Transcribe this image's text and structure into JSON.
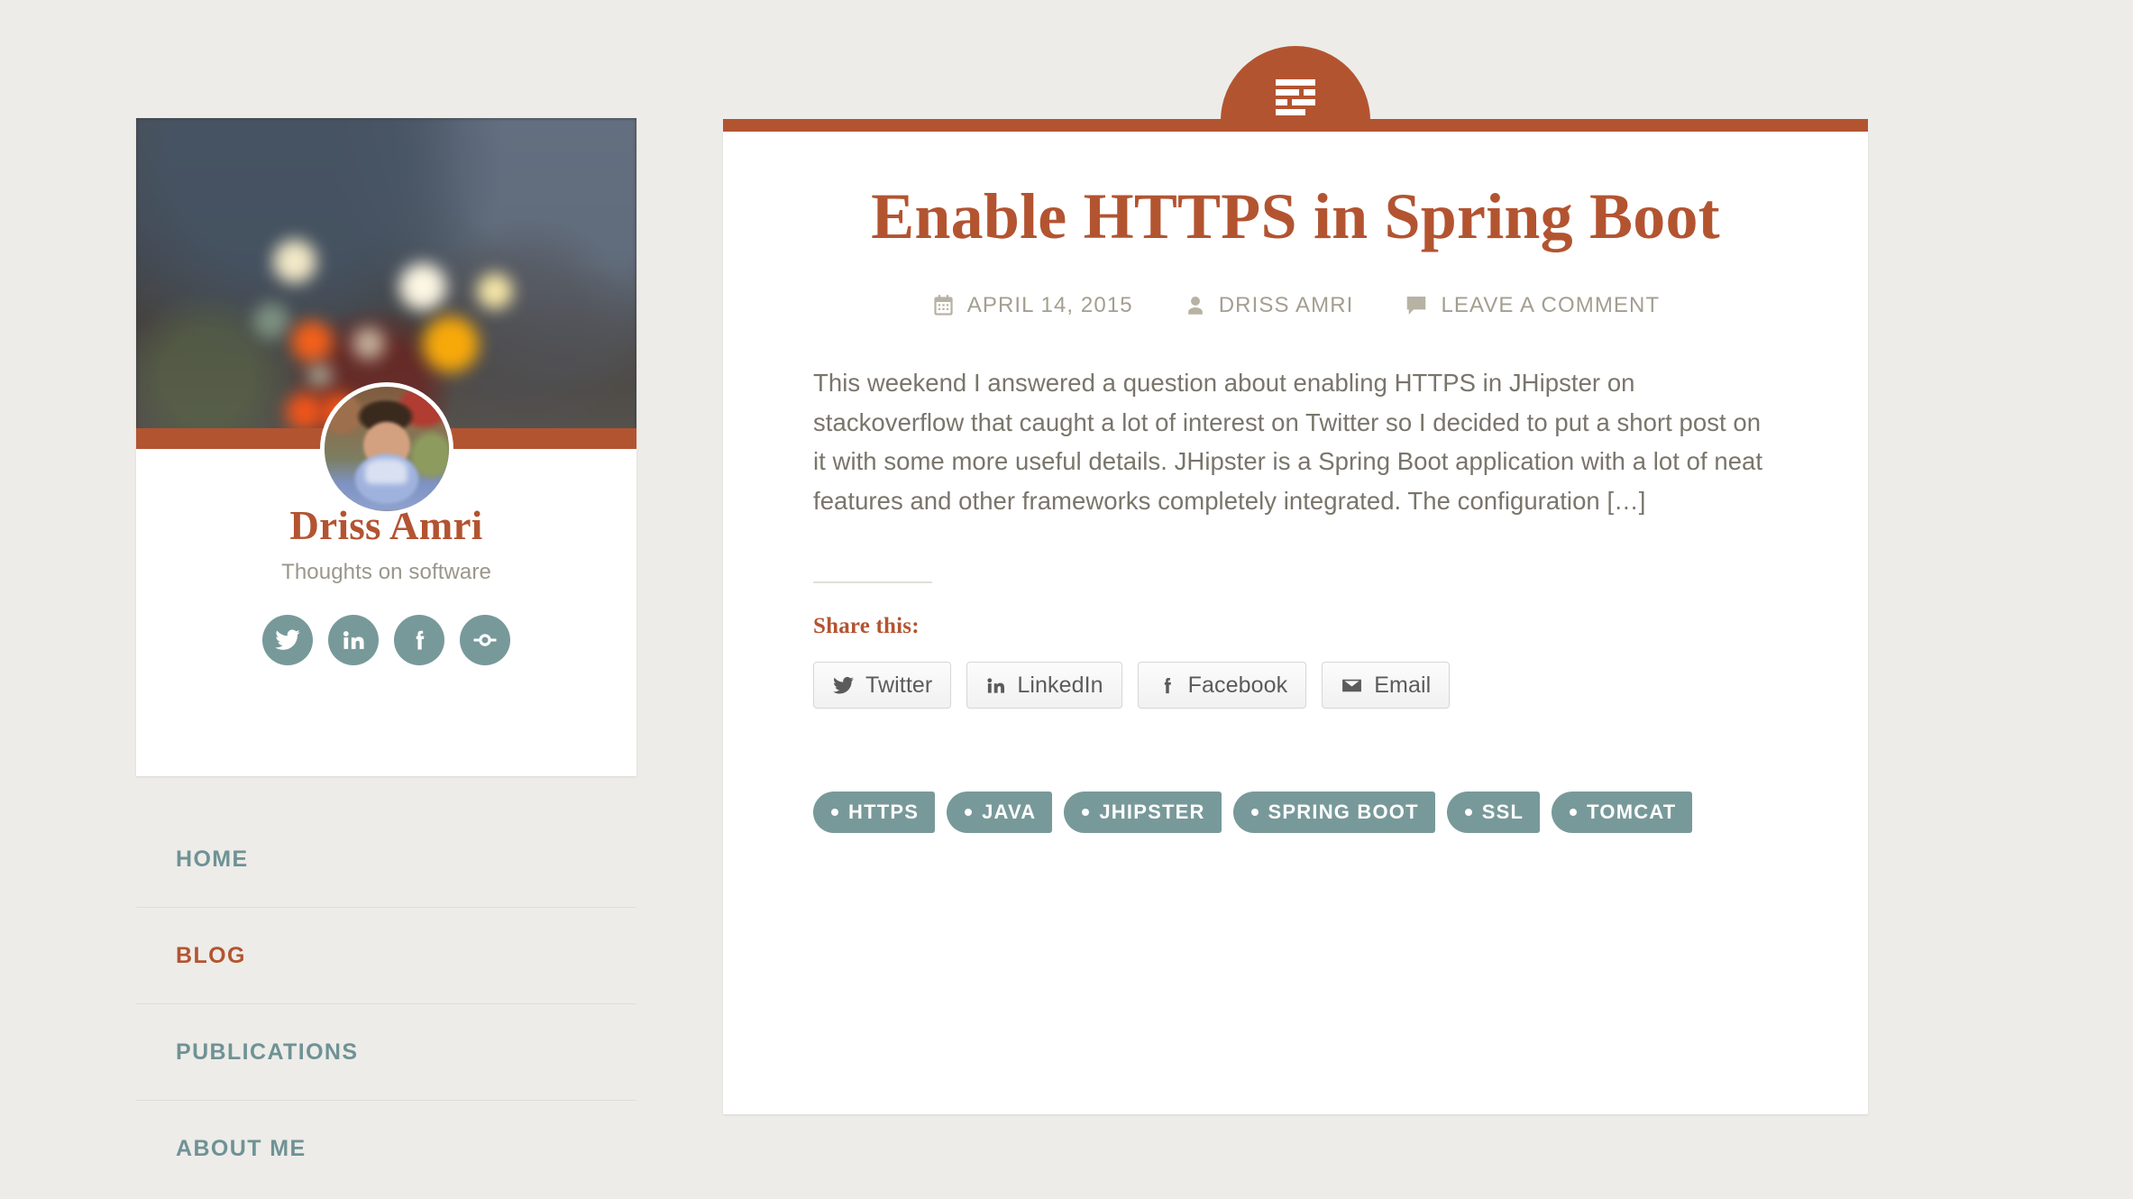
{
  "theme": {
    "background": "#edece8",
    "accent_orange": "#b35431",
    "accent_teal": "#78999a",
    "card_white": "#ffffff",
    "muted_text": "#79756b"
  },
  "sidebar": {
    "site_title": "Driss Amri",
    "tagline": "Thoughts on software",
    "avatar_name": "avatar",
    "social": [
      {
        "name": "twitter",
        "label": "Twitter"
      },
      {
        "name": "linkedin",
        "label": "LinkedIn"
      },
      {
        "name": "facebook",
        "label": "Facebook"
      },
      {
        "name": "link",
        "label": "Link"
      }
    ],
    "nav": [
      {
        "label": "HOME",
        "active": false
      },
      {
        "label": "BLOG",
        "active": true
      },
      {
        "label": "PUBLICATIONS",
        "active": false
      },
      {
        "label": "ABOUT ME",
        "active": false
      }
    ]
  },
  "post": {
    "format_icon": "text-lines-icon",
    "title": "Enable HTTPS in Spring Boot",
    "meta": {
      "date": "APRIL 14, 2015",
      "author": "DRISS AMRI",
      "comments": "LEAVE A COMMENT"
    },
    "excerpt": "This weekend I answered a question about enabling HTTPS in JHipster on stackoverflow that caught a lot of interest on Twitter so I decided to put a short post on it with some more useful details. JHipster is a Spring Boot application with a lot of neat features and other frameworks completely integrated. The configuration […]",
    "share": {
      "title": "Share this:",
      "buttons": [
        {
          "label": "Twitter",
          "icon": "twitter-icon"
        },
        {
          "label": "LinkedIn",
          "icon": "linkedin-icon"
        },
        {
          "label": "Facebook",
          "icon": "facebook-icon"
        },
        {
          "label": "Email",
          "icon": "envelope-icon"
        }
      ]
    },
    "tags": [
      {
        "label": "HTTPS"
      },
      {
        "label": "JAVA"
      },
      {
        "label": "JHIPSTER"
      },
      {
        "label": "SPRING BOOT"
      },
      {
        "label": "SSL"
      },
      {
        "label": "TOMCAT"
      }
    ]
  }
}
